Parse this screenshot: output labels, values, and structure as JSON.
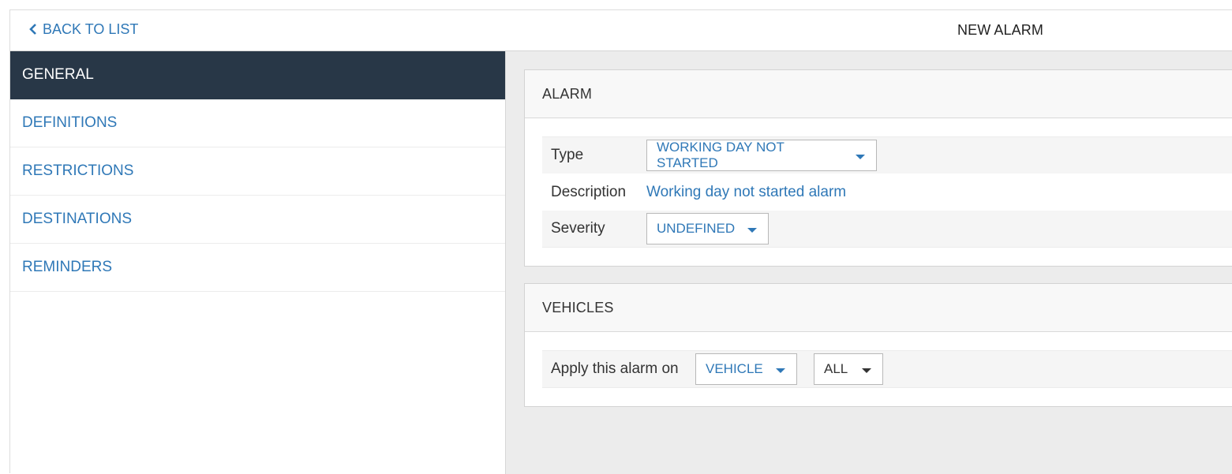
{
  "header": {
    "back_label": "BACK TO LIST",
    "title": "NEW ALARM"
  },
  "sidebar": {
    "items": [
      {
        "label": "GENERAL",
        "active": true
      },
      {
        "label": "DEFINITIONS",
        "active": false
      },
      {
        "label": "RESTRICTIONS",
        "active": false
      },
      {
        "label": "DESTINATIONS",
        "active": false
      },
      {
        "label": "REMINDERS",
        "active": false
      }
    ]
  },
  "alarm_panel": {
    "title": "ALARM",
    "type_label": "Type",
    "type_value": "WORKING DAY NOT STARTED",
    "description_label": "Description",
    "description_value": "Working day not started alarm",
    "severity_label": "Severity",
    "severity_value": "UNDEFINED"
  },
  "vehicles_panel": {
    "title": "VEHICLES",
    "apply_label": "Apply this alarm on",
    "target_value": "VEHICLE",
    "scope_value": "ALL"
  },
  "colors": {
    "accent": "#2f78b7",
    "sidebar_active_bg": "#283747",
    "main_bg": "#ececec"
  },
  "icons": {
    "back": "chevron-left-icon",
    "dropdown": "caret-down-icon"
  }
}
